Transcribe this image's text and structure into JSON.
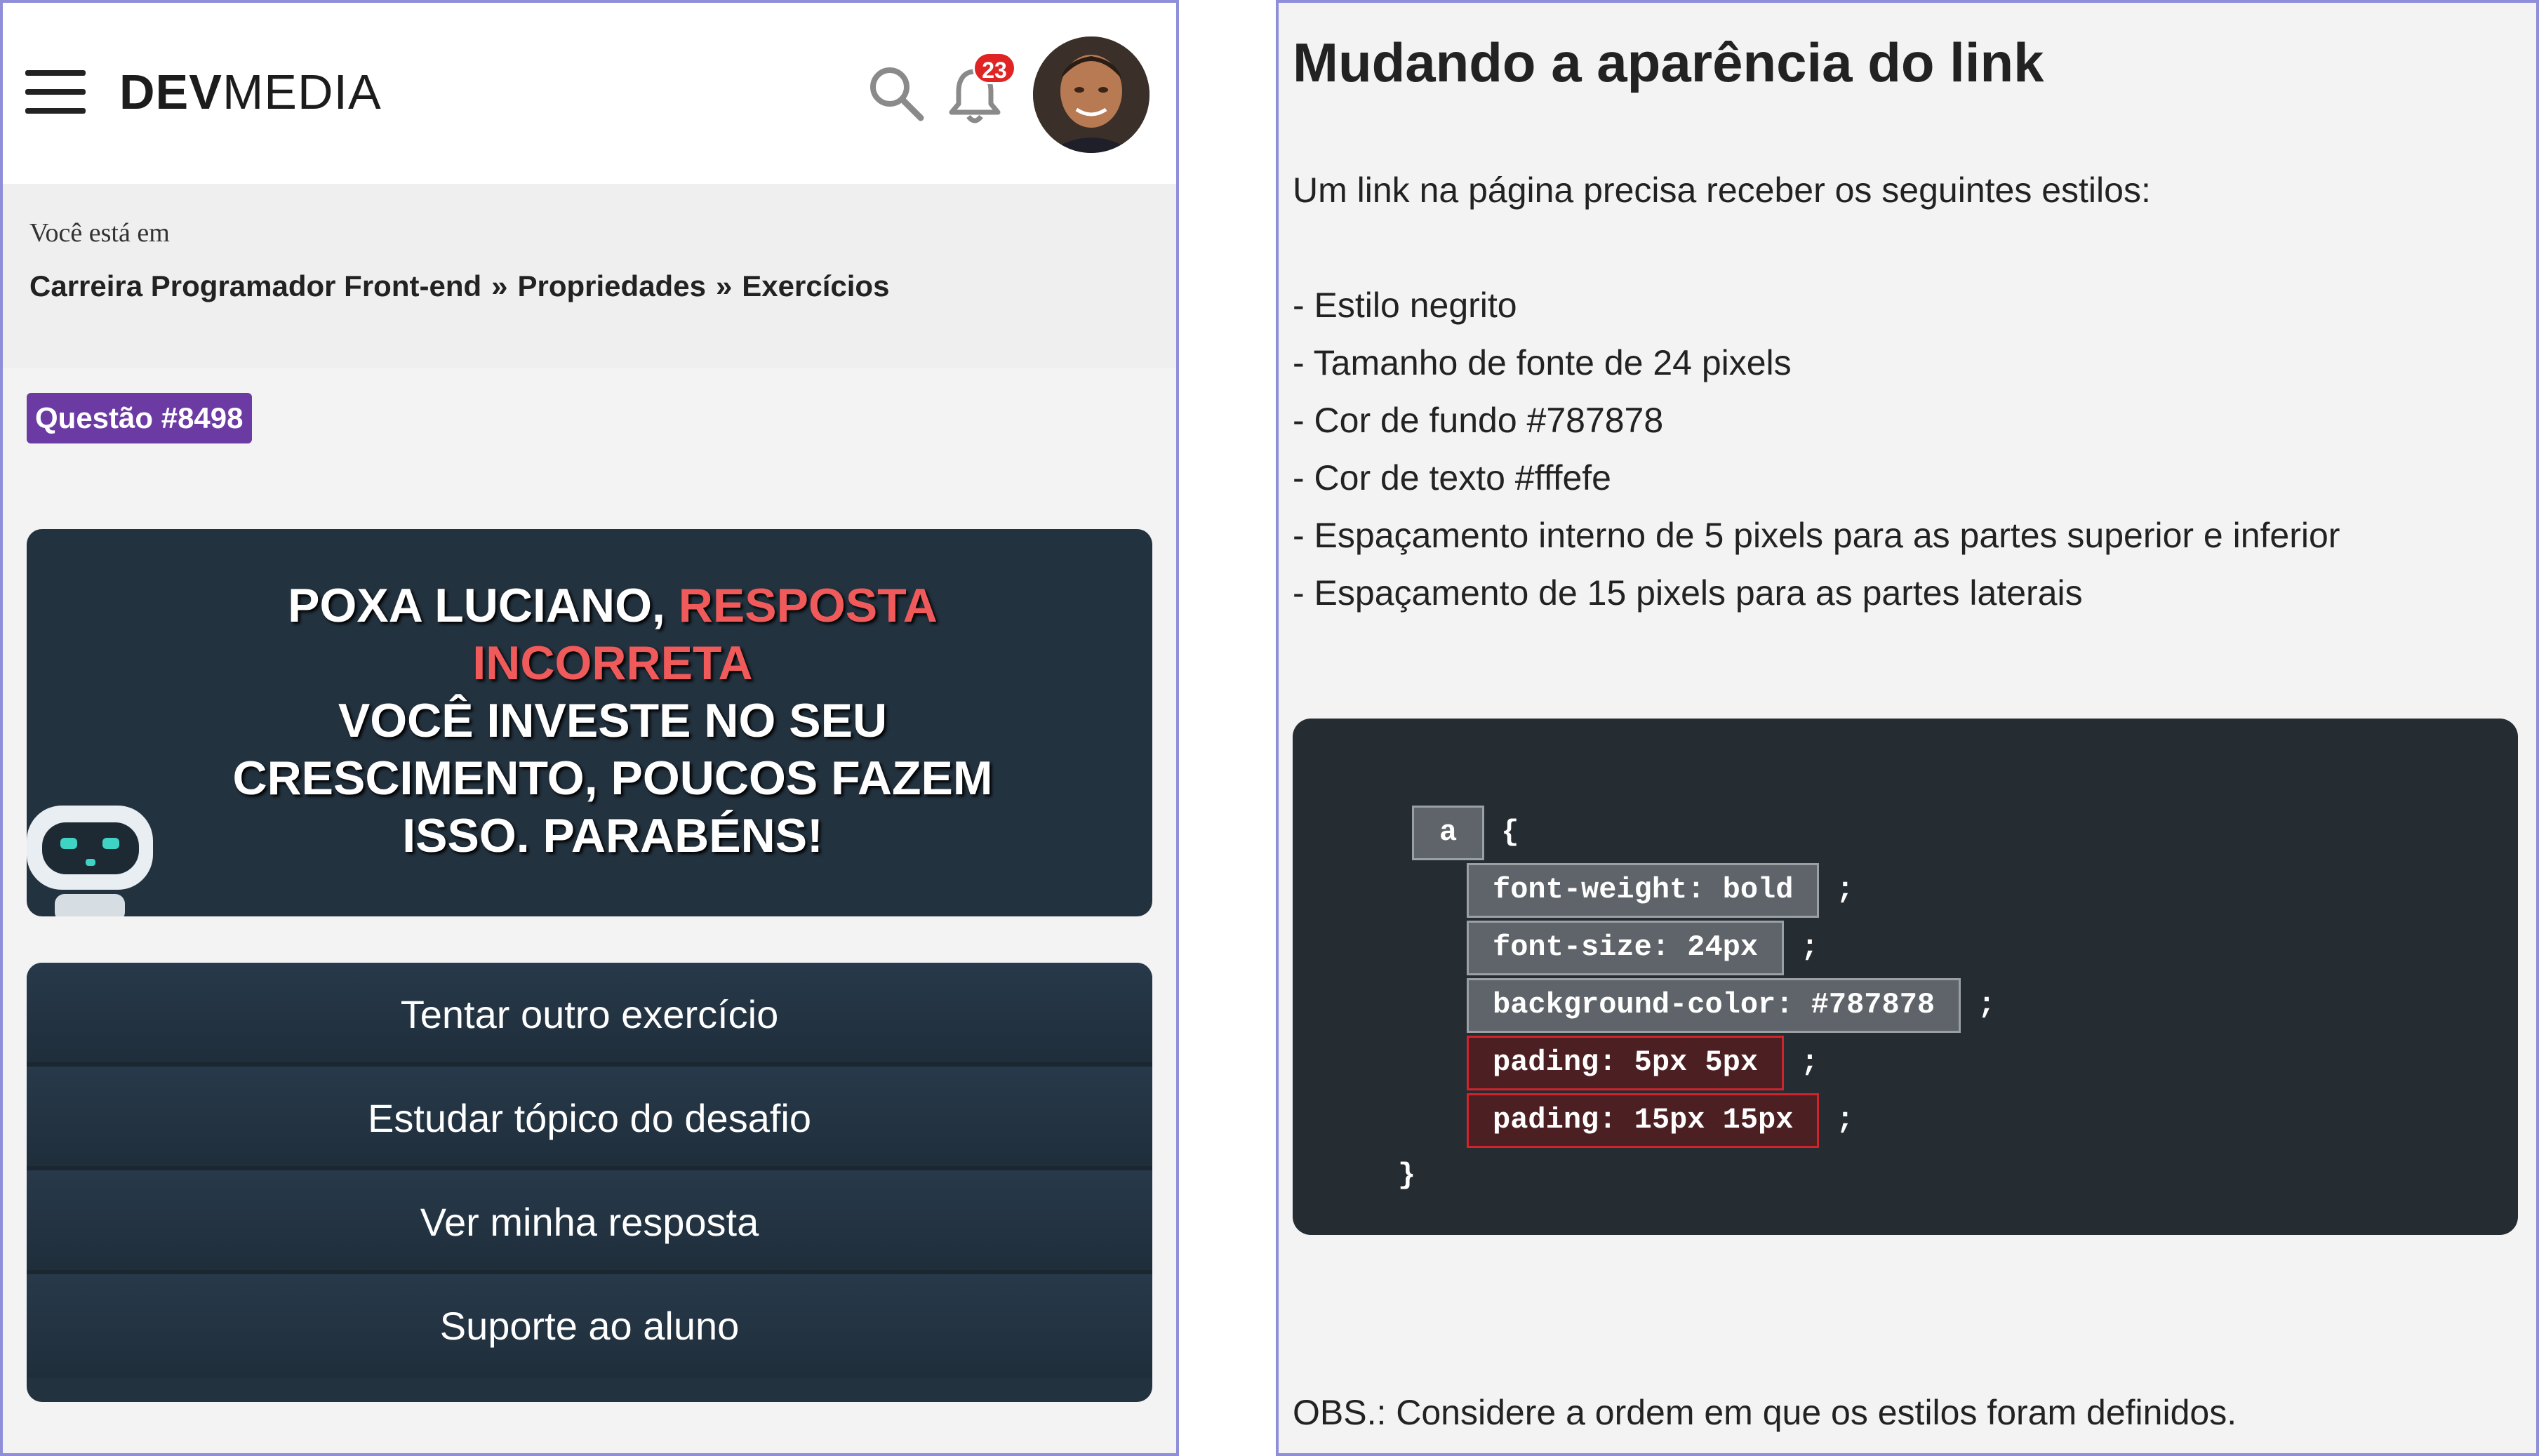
{
  "left": {
    "header": {
      "logo_bold": "DEV",
      "logo_light": "MEDIA",
      "notification_count": "23",
      "icons": [
        "menu-icon",
        "search-icon",
        "bell-icon"
      ]
    },
    "breadcrumb": {
      "label": "Você está em",
      "items": [
        "Carreira Programador Front-end",
        "Propriedades",
        "Exercícios"
      ],
      "separator": "»"
    },
    "question_badge": "Questão #8498",
    "result": {
      "line_white_1": "POXA LUCIANO, ",
      "line_red": "RESPOSTA INCORRETA",
      "line_white_2": "VOCÊ INVESTE NO SEU CRESCIMENTO, POUCOS FAZEM ISSO. PARABÉNS!"
    },
    "actions": [
      "Tentar outro exercício",
      "Estudar tópico do desafio",
      "Ver minha resposta",
      "Suporte ao aluno"
    ]
  },
  "right": {
    "title": "Mudando a aparência do link",
    "intro": "Um link na página precisa receber os seguintes estilos:",
    "requirements": [
      "- Estilo negrito",
      "- Tamanho de fonte de 24 pixels",
      "- Cor de fundo #787878",
      "- Cor de texto #fffefe",
      "- Espaçamento interno de 5 pixels para as partes superior e inferior",
      "- Espaçamento de 15 pixels para as partes laterais"
    ],
    "code": {
      "selector": "a",
      "open_brace": "{",
      "close_brace": "}",
      "semicolon": ";",
      "lines": [
        {
          "text": "font-weight: bold",
          "status": "neutral"
        },
        {
          "text": "font-size: 24px",
          "status": "neutral"
        },
        {
          "text": "background-color: #787878",
          "status": "neutral"
        },
        {
          "text": "pading: 5px 5px",
          "status": "incorrect"
        },
        {
          "text": "pading: 15px 15px",
          "status": "incorrect"
        }
      ]
    },
    "obs": "OBS.: Considere a ordem em que os estilos foram definidos."
  },
  "colors": {
    "question_badge": "#6b3aa3",
    "card_bg": "#23323f",
    "incorrect_text": "#f05a5a",
    "token_bg": "#5e6469",
    "token_error_border": "#d0242d",
    "panel_border": "#8f8ed8"
  }
}
